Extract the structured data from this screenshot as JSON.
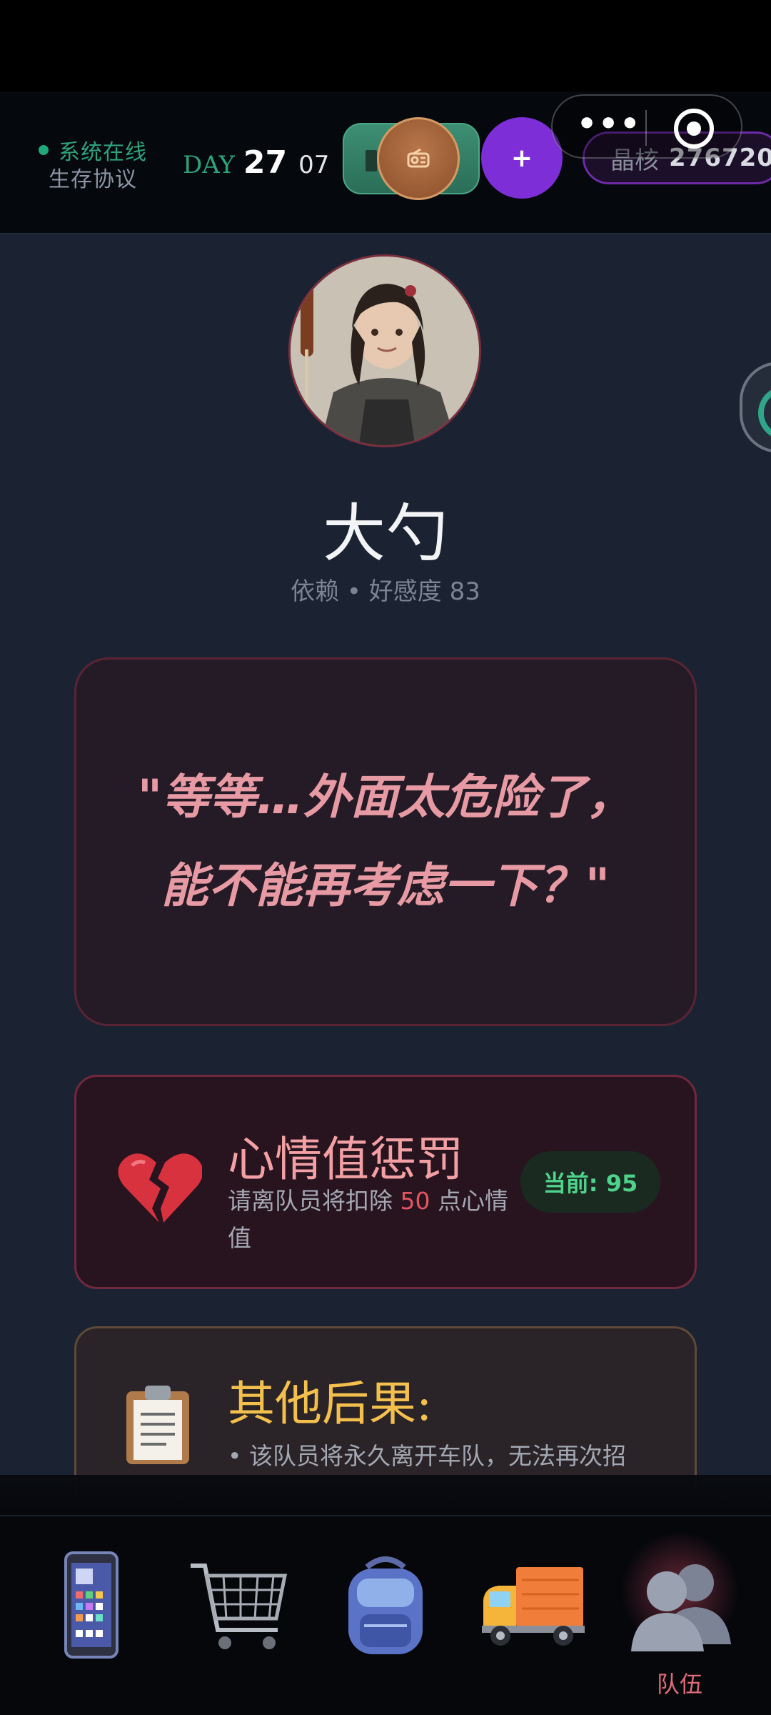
{
  "header": {
    "status_online": "系统在线",
    "protocol": "生存协议",
    "day_label": "DAY",
    "day_number": "27",
    "time": "07",
    "plus_label": "+",
    "crystal_label": "晶核",
    "crystal_value": "276720"
  },
  "character": {
    "name": "大勺",
    "affinity_text": "依赖 • 好感度 83"
  },
  "quote": {
    "text": "\"等等…外面太危险了，能不能再考虑一下？\""
  },
  "penalty": {
    "title": "心情值惩罚",
    "desc_prefix": "请离队员将扣除 ",
    "desc_number": "50",
    "desc_suffix": " 点心情值",
    "current": "当前: 95"
  },
  "consequence": {
    "title": "其他后果:",
    "item1": "• 该队员将永久离开车队，无法再次招"
  },
  "nav": {
    "items": [
      {
        "icon": "phone-icon",
        "label": ""
      },
      {
        "icon": "shopping-cart-icon",
        "label": ""
      },
      {
        "icon": "backpack-icon",
        "label": ""
      },
      {
        "icon": "truck-icon",
        "label": ""
      },
      {
        "icon": "team-icon",
        "label": "队伍"
      }
    ]
  },
  "colors": {
    "accent_green": "#2ea37a",
    "accent_purple": "#7d2ed6",
    "quote_pink": "#e79aa3",
    "penalty_red": "#e25563",
    "consequence_gold": "#f3c04e"
  }
}
